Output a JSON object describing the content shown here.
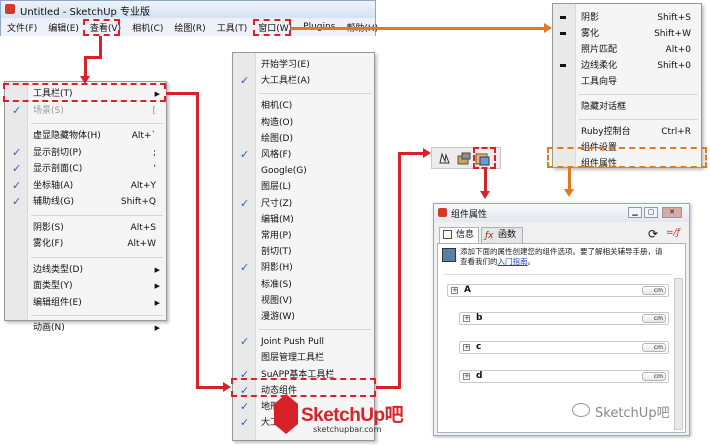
{
  "window": {
    "title": "Untitled - SketchUp 专业版"
  },
  "menubar": [
    "文件(F)",
    "编辑(E)",
    "查看(V)",
    "相机(C)",
    "绘图(R)",
    "工具(T)",
    "窗口(W)",
    "Plugins",
    "帮助(H)"
  ],
  "view_menu": [
    {
      "label": "工具栏(T)",
      "shortcut": "",
      "submenu": true,
      "highlight": true
    },
    {
      "label": "场景(S)",
      "shortcut": "[",
      "check": true,
      "disabled": true
    },
    {
      "sep": true
    },
    {
      "label": "虚显隐藏物体(H)",
      "shortcut": "Alt+`"
    },
    {
      "label": "显示剖切(P)",
      "shortcut": ";",
      "check": true
    },
    {
      "label": "显示剖面(C)",
      "shortcut": "'",
      "check": true
    },
    {
      "label": "坐标轴(A)",
      "shortcut": "Alt+Y",
      "check": true
    },
    {
      "label": "辅助线(G)",
      "shortcut": "Shift+Q",
      "check": true
    },
    {
      "sep": true
    },
    {
      "label": "阴影(S)",
      "shortcut": "Alt+S"
    },
    {
      "label": "雾化(F)",
      "shortcut": "Alt+W"
    },
    {
      "sep": true
    },
    {
      "label": "边线类型(D)",
      "submenu": true
    },
    {
      "label": "面类型(Y)",
      "submenu": true
    },
    {
      "label": "编辑组件(E)",
      "submenu": true
    },
    {
      "sep": true
    },
    {
      "label": "动画(N)",
      "submenu": true
    }
  ],
  "toolbar_menu": [
    {
      "label": "开始学习(E)"
    },
    {
      "label": "大工具栏(A)",
      "check": true
    },
    {
      "sep": true
    },
    {
      "label": "相机(C)"
    },
    {
      "label": "构造(O)"
    },
    {
      "label": "绘图(D)"
    },
    {
      "label": "风格(F)",
      "check": true
    },
    {
      "label": "Google(G)"
    },
    {
      "label": "图层(L)"
    },
    {
      "label": "尺寸(Z)",
      "check": true
    },
    {
      "label": "编辑(M)"
    },
    {
      "label": "常用(P)"
    },
    {
      "label": "剖切(T)"
    },
    {
      "label": "阴影(H)",
      "check": true
    },
    {
      "label": "标准(S)"
    },
    {
      "label": "视图(V)"
    },
    {
      "label": "漫游(W)"
    },
    {
      "sep": true
    },
    {
      "label": "Joint Push Pull",
      "check": true
    },
    {
      "label": "图层管理工具栏"
    },
    {
      "label": "SuAPP基本工具栏",
      "check": true
    },
    {
      "label": "动态组件",
      "check": true,
      "highlight": true
    },
    {
      "label": "地形",
      "check": true
    },
    {
      "label": "大工具栏",
      "check": true
    }
  ],
  "window_menu": [
    {
      "label": "阴影",
      "shortcut": "Shift+S",
      "dot": true
    },
    {
      "label": "雾化",
      "shortcut": "Shift+W",
      "dot": true
    },
    {
      "label": "照片匹配",
      "shortcut": "Alt+0"
    },
    {
      "label": "边线柔化",
      "shortcut": "Shift+0",
      "dot": true
    },
    {
      "label": "工具向导",
      "shortcut": ""
    },
    {
      "sep": true
    },
    {
      "label": "隐藏对话框",
      "shortcut": ""
    },
    {
      "sep": true
    },
    {
      "label": "Ruby控制台",
      "shortcut": "Ctrl+R"
    },
    {
      "label": "组件设置",
      "shortcut": ""
    },
    {
      "label": "组件属性",
      "shortcut": "",
      "highlight": true
    }
  ],
  "dialog": {
    "title": "组件属性",
    "tabs": [
      "信息",
      "函数"
    ],
    "info_text_1": "添加下面的属性创建您的组件选项。要了解相关辅导手册，请",
    "info_text_2": "查看我们的",
    "info_link": "入门指南",
    "info_text_3": "。",
    "unit": "cm",
    "components": [
      "A",
      "b",
      "c",
      "d"
    ]
  },
  "watermark": {
    "brand": "SketchUp吧",
    "url": "sketchupbar.com",
    "wechat": "SketchUp吧"
  },
  "colors": {
    "highlight_dash": "#d8222a",
    "orange_arrow": "#e07a1f",
    "check": "#2d5fb2"
  }
}
